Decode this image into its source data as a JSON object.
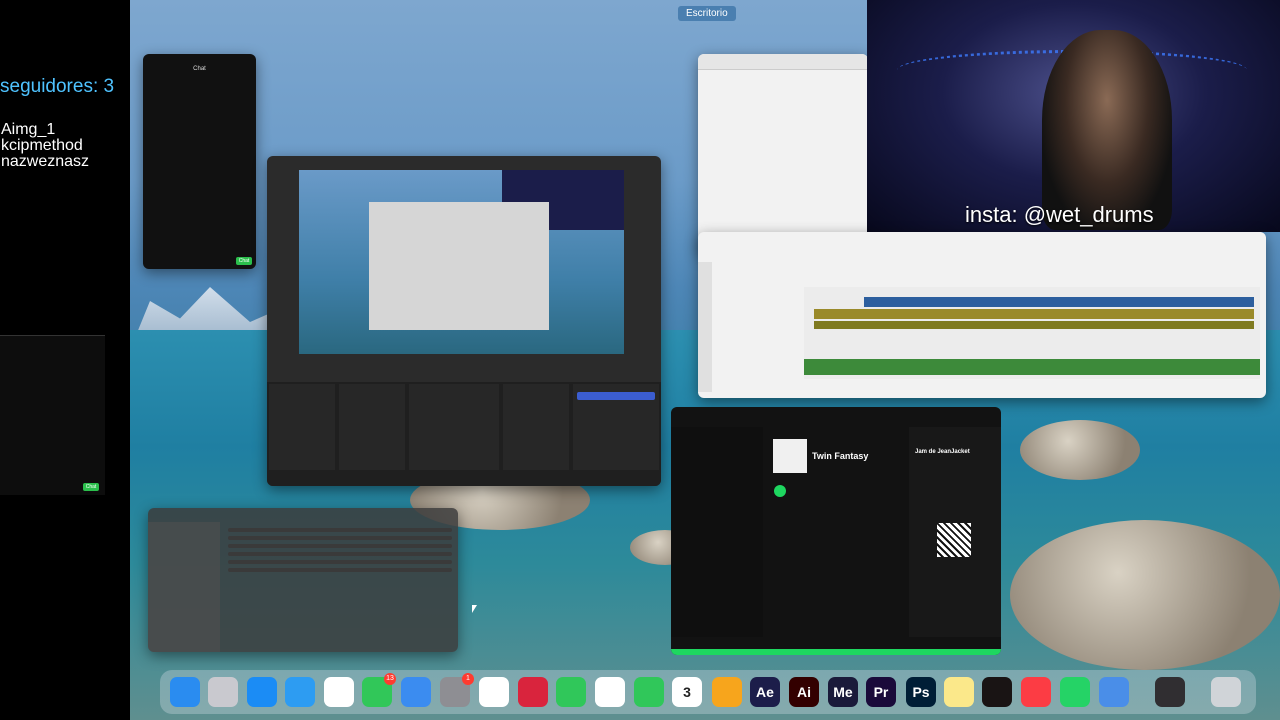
{
  "overlay": {
    "followers": "seguidores: 3",
    "names": [
      "Aimg_1",
      "kcipmethod",
      "nazweznasz"
    ],
    "webcam_caption": "insta: @wet_drums"
  },
  "desktop": {
    "space_label": "Escritorio"
  },
  "chat_window": {
    "title": "Chat",
    "send_label": "Chat"
  },
  "chat_window_left": {
    "send_label": "Chat"
  },
  "spotify": {
    "album_title": "Twin Fantasy",
    "side_title": "Jam de JeanJacket"
  },
  "dock": {
    "calendar_day": "3",
    "items": [
      {
        "name": "finder",
        "label": "",
        "color": "#2a8cf0"
      },
      {
        "name": "launchpad",
        "label": "",
        "color": "#c9c9cf"
      },
      {
        "name": "app-store",
        "label": "",
        "color": "#1b8cf5"
      },
      {
        "name": "safari",
        "label": "",
        "color": "#2d9cf2"
      },
      {
        "name": "chrome",
        "label": "",
        "color": "#ffffff"
      },
      {
        "name": "messages",
        "label": "",
        "color": "#31c759",
        "badge": "13"
      },
      {
        "name": "mail",
        "label": "",
        "color": "#3b8cf0"
      },
      {
        "name": "system-settings",
        "label": "",
        "color": "#8e8e93",
        "badge": "1"
      },
      {
        "name": "photos",
        "label": "",
        "color": "#ffffff"
      },
      {
        "name": "photo-booth",
        "label": "",
        "color": "#d9243d"
      },
      {
        "name": "facetime",
        "label": "",
        "color": "#30c75a"
      },
      {
        "name": "freeform",
        "label": "",
        "color": "#ffffff"
      },
      {
        "name": "phone",
        "label": "",
        "color": "#30c75a"
      },
      {
        "name": "calendar",
        "label": "3",
        "color": "#ffffff"
      },
      {
        "name": "pages",
        "label": "",
        "color": "#f7a51c"
      },
      {
        "name": "after-effects",
        "label": "Ae",
        "color": "#1c1d4a"
      },
      {
        "name": "illustrator",
        "label": "Ai",
        "color": "#330000"
      },
      {
        "name": "media-encoder",
        "label": "Me",
        "color": "#1a1a3a"
      },
      {
        "name": "premiere-pro",
        "label": "Pr",
        "color": "#1a0a3a"
      },
      {
        "name": "photoshop",
        "label": "Ps",
        "color": "#001e36"
      },
      {
        "name": "notes",
        "label": "",
        "color": "#fbe88a"
      },
      {
        "name": "spotify",
        "label": "",
        "color": "#191414"
      },
      {
        "name": "music",
        "label": "",
        "color": "#fc3c44"
      },
      {
        "name": "whatsapp",
        "label": "",
        "color": "#25d366"
      },
      {
        "name": "simulator",
        "label": "",
        "color": "#4a8ee8"
      },
      {
        "name": "obs",
        "label": "",
        "color": "#302e31"
      },
      {
        "name": "trash",
        "label": "",
        "color": "#d0d4d8"
      }
    ]
  }
}
